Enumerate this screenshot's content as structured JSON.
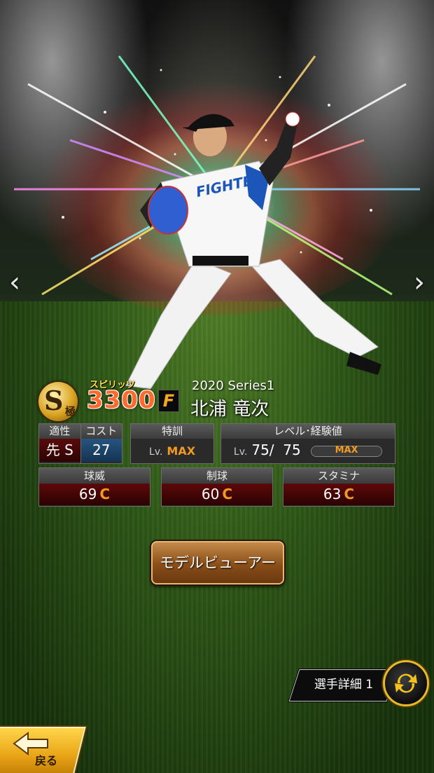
{
  "navigation": {
    "prev_arrow": "‹",
    "next_arrow": "›"
  },
  "card": {
    "rank": "S",
    "rank_sub": "極",
    "spirits_label": "スピリッツ",
    "spirits_value": "3300",
    "team_logo": "F",
    "series": "2020 Series1",
    "player_name": "北浦 竜次"
  },
  "stats": {
    "aptitude_header": "適性",
    "aptitude_value": "先 S",
    "cost_header": "コスト",
    "cost_value": "27",
    "training_header": "特訓",
    "training_lv_prefix": "Lv.",
    "training_value": "MAX",
    "level_header": "レベル･経験値",
    "level_lv_prefix": "Lv.",
    "level_value": "75/  75",
    "exp_bar_label": "MAX",
    "exp_fill": 1.0
  },
  "abilities": [
    {
      "name": "球威",
      "value": "69",
      "grade": "C"
    },
    {
      "name": "制球",
      "value": "60",
      "grade": "C"
    },
    {
      "name": "スタミナ",
      "value": "63",
      "grade": "C"
    }
  ],
  "buttons": {
    "model_viewer": "モデルビューアー",
    "player_detail": "選手詳細 1",
    "back": "戻る"
  },
  "jersey_text": "FIGHTERS",
  "colors": {
    "spirits": "#ff6b2e",
    "grade": "#f29a1f",
    "ability_bg": "#5c0909",
    "cost_bg": "#27547e",
    "button_bronze": "#8a4e18",
    "back_gold": "#e9a417"
  }
}
